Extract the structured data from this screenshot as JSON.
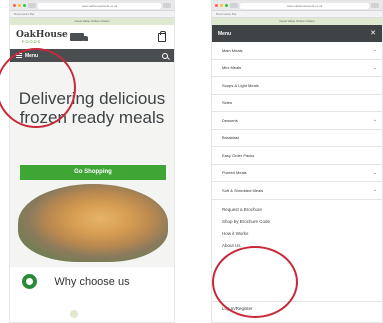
{
  "browser": {
    "left_url": "www.oakhousefoods.co.uk",
    "right_url": "www.oakhousefoods.co.uk",
    "bookmarks_text": "Bookmarks Bar",
    "promo_text": "Great Value Online Orders"
  },
  "left_screen": {
    "brand_main": "OakHouse",
    "brand_sub": "FOODS",
    "menu_label": "Menu",
    "hero_title": "Delivering delicious frozen ready meals",
    "shop_button": "Go Shopping",
    "why_heading": "Why choose us"
  },
  "right_screen": {
    "menu_title": "Menu",
    "close_glyph": "✕",
    "menu_items": [
      {
        "label": "Main Meals",
        "has_submenu": true
      },
      {
        "label": "Mini Meals",
        "has_submenu": true
      },
      {
        "label": "Soups & Light Meals",
        "has_submenu": false
      },
      {
        "label": "Sides",
        "has_submenu": false
      },
      {
        "label": "Desserts",
        "has_submenu": true
      },
      {
        "label": "Breakfast",
        "has_submenu": false
      },
      {
        "label": "Easy Order Packs",
        "has_submenu": false
      },
      {
        "label": "Pureed Meals",
        "has_submenu": true
      },
      {
        "label": "Soft & Shredded Meals",
        "has_submenu": true
      }
    ],
    "links": [
      "Request a Brochure",
      "Shop by Brochure Code",
      "How it Works",
      "About Us"
    ],
    "login": "Log In/Register"
  },
  "colors": {
    "accent_green": "#3fa535",
    "menubar_dark": "#4a4e51",
    "highlight_ring": "#c8283a"
  }
}
